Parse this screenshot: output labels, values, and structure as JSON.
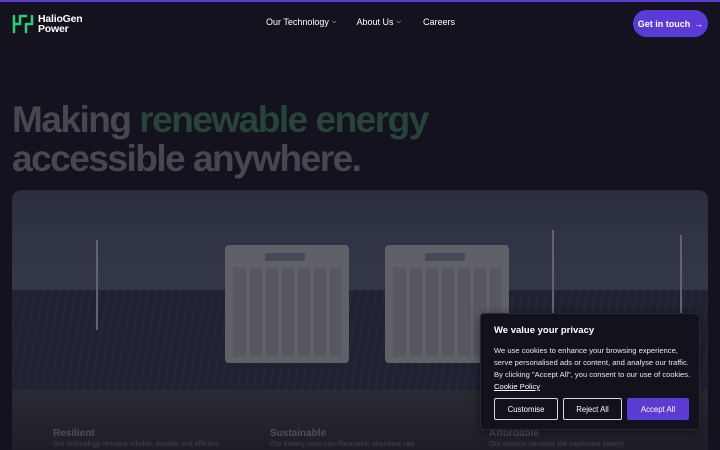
{
  "header": {
    "logo_line1": "HalioGen",
    "logo_line2": "Power",
    "nav": [
      {
        "label": "Our Technology",
        "has_dropdown": true
      },
      {
        "label": "About Us",
        "has_dropdown": true
      },
      {
        "label": "Careers",
        "has_dropdown": false
      }
    ],
    "cta_label": "Get in touch",
    "cta_icon": "arrow-right-icon"
  },
  "hero": {
    "title_part1": "Making",
    "title_accent": "renewable energy",
    "title_part2": "accessible anywhere."
  },
  "features": [
    {
      "title": "Resilient",
      "text": "Our technology remains reliable, durable and efficient"
    },
    {
      "title": "Sustainable",
      "text": "Our battery uses non-flammable abundant raw"
    },
    {
      "title": "Affordable",
      "text": "Our solution removes the expensive battery"
    }
  ],
  "cookie": {
    "title": "We value your privacy",
    "text": "We use cookies to enhance your browsing experience, serve personalised ads or content, and analyse our traffic. By clicking \"Accept All\", you consent to our use of cookies.",
    "link": "Cookie Policy",
    "customise": "Customise",
    "reject": "Reject All",
    "accept": "Accept All"
  },
  "colors": {
    "background": "#14121e",
    "brand_purple": "#5b3bd6",
    "accent_green": "#3f8a5c",
    "logo_green": "#2ecc71"
  }
}
